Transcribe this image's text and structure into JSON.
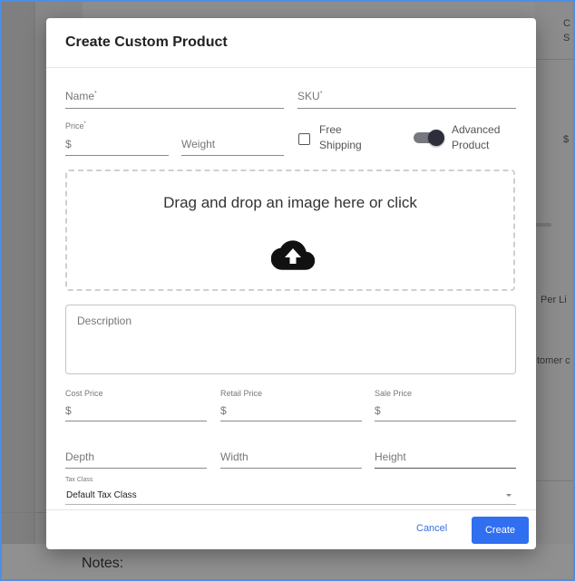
{
  "background": {
    "snippets": [
      "C",
      "S",
      "$",
      "Per Li",
      "tomer c"
    ],
    "notes_label": "Notes:"
  },
  "modal": {
    "title": "Create Custom Product",
    "name_label": "Name",
    "sku_label": "SKU",
    "required_mark": "*",
    "price_label": "Price",
    "price_prefix": "$",
    "weight_label": "Weight",
    "free_shipping_label": "Free Shipping",
    "free_shipping_checked": false,
    "advanced_product_label": "Advanced Product",
    "advanced_product_on": true,
    "dropzone_text": "Drag and drop an image here or click",
    "dropzone_icon": "cloud-upload-icon",
    "description_placeholder": "Description",
    "cost_price_label": "Cost Price",
    "retail_price_label": "Retail Price",
    "sale_price_label": "Sale Price",
    "currency_prefix": "$",
    "depth_label": "Depth",
    "width_label": "Width",
    "height_label": "Height",
    "tax_class_label": "Tax Class",
    "tax_class_value": "Default Tax Class",
    "cancel_label": "Cancel",
    "create_label": "Create"
  },
  "colors": {
    "accent": "#2f6ff0",
    "frame": "#4a8fe8",
    "toggle_thumb": "#2d2d3c"
  }
}
